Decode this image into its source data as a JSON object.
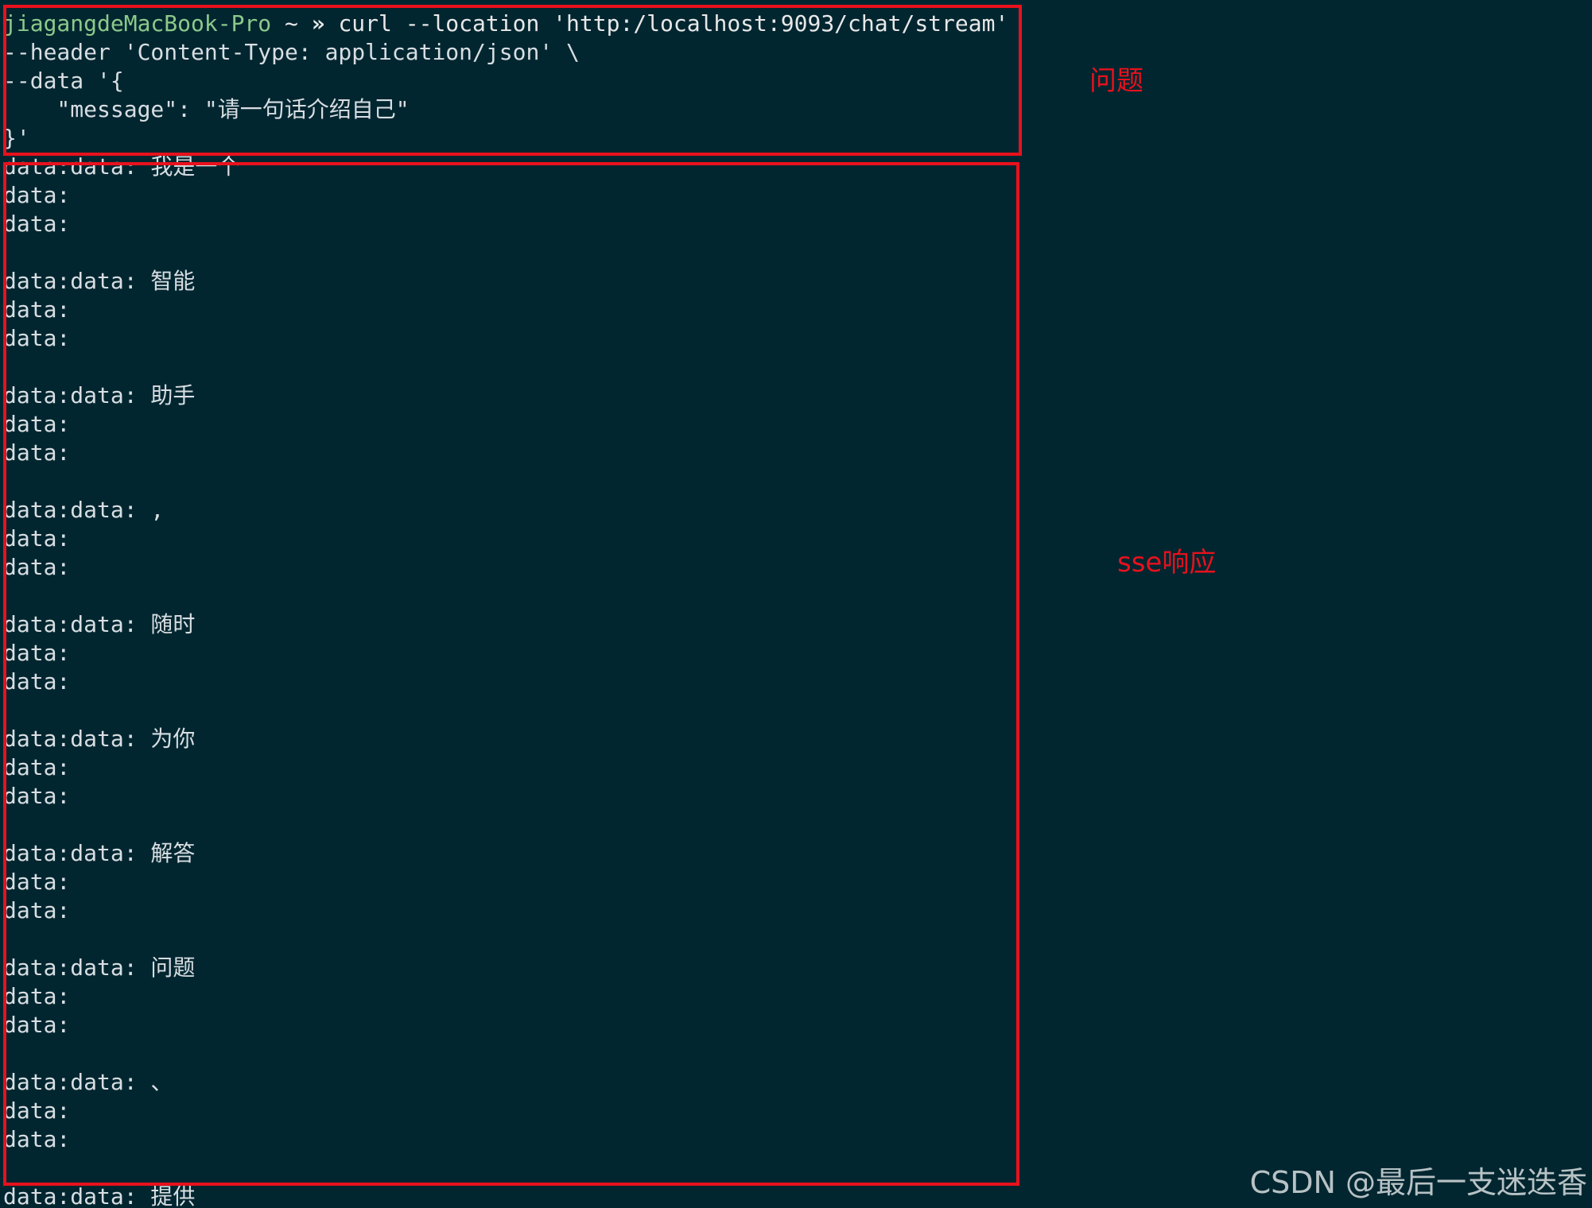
{
  "terminal": {
    "prompt": {
      "user_host": "jiagangdeMacBook-Pro",
      "tilde": " ~ ",
      "symbol": "»",
      "command": " curl --location 'http:/localhost:9093/chat/stream' \\"
    },
    "command_lines": [
      "--header 'Content-Type: application/json' \\",
      "--data '{",
      "    \"message\": \"请一句话介绍自己\"",
      "}'"
    ],
    "output_lines": [
      "data:data: 我是一个",
      "data:",
      "data:",
      "",
      "data:data: 智能",
      "data:",
      "data:",
      "",
      "data:data: 助手",
      "data:",
      "data:",
      "",
      "data:data: ,",
      "data:",
      "data:",
      "",
      "data:data: 随时",
      "data:",
      "data:",
      "",
      "data:data: 为你",
      "data:",
      "data:",
      "",
      "data:data: 解答",
      "data:",
      "data:",
      "",
      "data:data: 问题",
      "data:",
      "data:",
      "",
      "data:data: 、",
      "data:",
      "data:",
      "",
      "data:data: 提供"
    ]
  },
  "annotations": {
    "question": "问题",
    "sse_response": "sse响应"
  },
  "watermark": "CSDN @最后一支迷迭香",
  "colors": {
    "background": "#012630",
    "annotation_red": "#e8111d",
    "prompt_green": "#8cc98a"
  }
}
